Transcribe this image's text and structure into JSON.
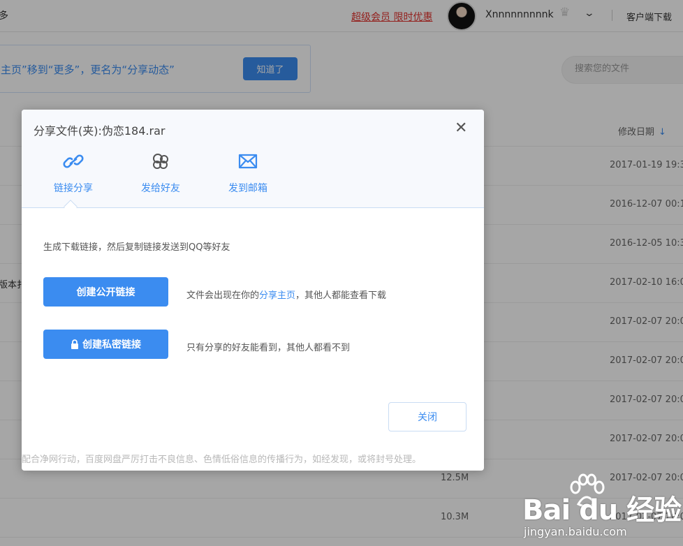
{
  "topbar": {
    "more_tab": "多",
    "vip_link": "超级会员 限时优惠",
    "username": "Xnnnnnnnnnk",
    "client_download": "客户端下载"
  },
  "tip": {
    "text": "主页”移到“更多”，更名为“分享动态”",
    "button": "知道了"
  },
  "search": {
    "placeholder": "搜索您的文件"
  },
  "file_list": {
    "date_header": "修改日期",
    "rows": [
      {
        "name": "",
        "size": "",
        "date": "2017-01-19 19:3"
      },
      {
        "name": "",
        "size": "",
        "date": "2016-12-07 00:1"
      },
      {
        "name": "",
        "size": "",
        "date": "2016-12-05 10:3"
      },
      {
        "name": "版本扌",
        "size": "",
        "date": "2017-02-10 16:0"
      },
      {
        "name": "",
        "size": "",
        "date": "2017-02-07 20:0"
      },
      {
        "name": "",
        "size": "",
        "date": "2017-02-07 20:0"
      },
      {
        "name": "",
        "size": "",
        "date": "2017-02-07 20:0"
      },
      {
        "name": "",
        "size": "",
        "date": "2017-02-07 20:0"
      },
      {
        "name": "",
        "size": "12.5M",
        "date": "2017-02-07 20:0"
      },
      {
        "name": "",
        "size": "10.3M",
        "date": "2017-02-07 20:0"
      }
    ]
  },
  "dialog": {
    "title": "分享文件(夹):伪恋184.rar",
    "tabs": [
      {
        "label": "链接分享",
        "icon": "link-icon"
      },
      {
        "label": "发给好友",
        "icon": "friends-icon"
      },
      {
        "label": "发到邮箱",
        "icon": "mail-icon"
      }
    ],
    "description": "生成下载链接，然后复制链接发送到QQ等好友",
    "public_button": "创建公开链接",
    "public_note_before": "文件会出现在你的",
    "public_note_link": "分享主页",
    "public_note_after": "，其他人都能查看下载",
    "private_button": "创建私密链接",
    "private_note": "只有分享的好友能看到，其他人都看不到",
    "close_button": "关闭",
    "footer_notice": "配合净网行动，百度网盘严厉打击不良信息、色情低俗信息的传播行为，如经发现，或将封号处理。"
  },
  "watermark": {
    "brand": "Bai du 经验",
    "url": "jingyan.baidu.com"
  },
  "colors": {
    "accent": "#3b8cf0",
    "vip": "#e2322d"
  }
}
